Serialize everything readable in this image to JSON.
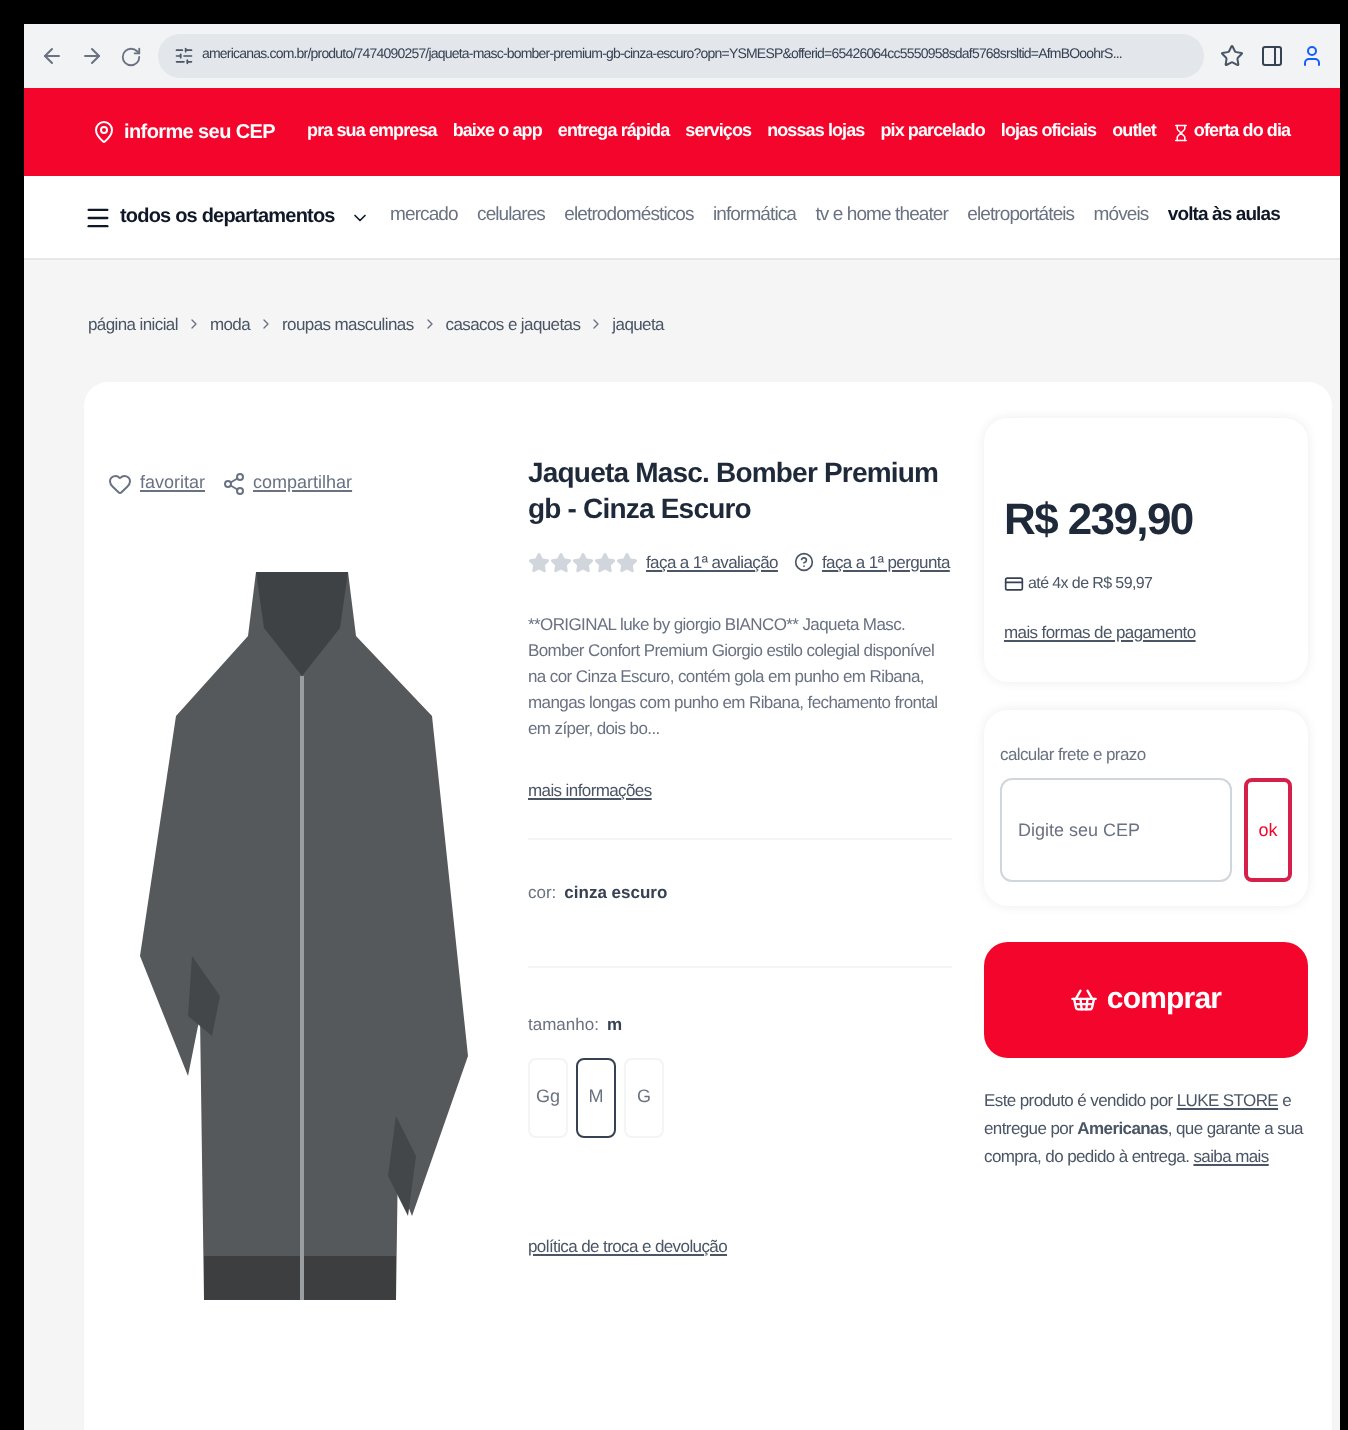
{
  "browser": {
    "url": "americanas.com.br/produto/7474090257/jaqueta-masc-bomber-premium-gb-cinza-escuro?opn=YSMESP&offerid=65426064cc5550958sdaf5768srsltid=AfmBOoohrS..."
  },
  "topbar": {
    "cep": "informe seu CEP",
    "links": [
      {
        "text": "pra sua empresa",
        "kind": "plain"
      },
      {
        "text": "baixe o app",
        "kind": "plain"
      },
      {
        "text": "entrega rápida",
        "kind": "plain"
      },
      {
        "text": "serviços",
        "kind": "plain"
      },
      {
        "text": "nossas lojas",
        "kind": "plain"
      },
      {
        "text": "pix parcelado",
        "kind": "plain"
      },
      {
        "text": "lojas oficiais",
        "kind": "plain"
      },
      {
        "text": "outlet",
        "kind": "plain"
      },
      {
        "text": "oferta do dia",
        "kind": "icon"
      }
    ]
  },
  "departments": {
    "menu": "todos os departamentos",
    "items": [
      {
        "text": "mercado",
        "bold": false
      },
      {
        "text": "celulares",
        "bold": false
      },
      {
        "text": "eletrodomésticos",
        "bold": false
      },
      {
        "text": "informática",
        "bold": false
      },
      {
        "text": "tv e home theater",
        "bold": false
      },
      {
        "text": "eletroportáteis",
        "bold": false
      },
      {
        "text": "móveis",
        "bold": false
      },
      {
        "text": "volta às aulas",
        "bold": true
      }
    ]
  },
  "breadcrumb": [
    "página inicial",
    "moda",
    "roupas masculinas",
    "casacos e jaquetas",
    "jaqueta"
  ],
  "product": {
    "favorite": "favoritar",
    "share": "compartilhar",
    "title": "Jaqueta Masc. Bomber Premium gb - Cinza Escuro",
    "stars": 0,
    "review_link": "faça a 1ª avaliação",
    "question_link": "faça a 1ª pergunta",
    "description": "**ORIGINAL luke by giorgio BIANCO** Jaqueta Masc. Bomber Confort Premium Giorgio estilo colegial disponível na cor Cinza Escuro, contém gola em punho em Ribana, mangas longas com punho em Ribana, fechamento frontal em zíper, dois bo...",
    "more_info": "mais informações",
    "color_label": "cor:",
    "color_value": "cinza escuro",
    "size_label": "tamanho:",
    "size_value": "m",
    "sizes": [
      {
        "label": "Gg",
        "selected": false
      },
      {
        "label": "M",
        "selected": true
      },
      {
        "label": "G",
        "selected": false
      }
    ],
    "return_policy": "política de troca e devolução"
  },
  "price": {
    "value": "R$ 239,90",
    "installments": "até 4x de R$ 59,97",
    "more_payment": "mais formas de pagamento"
  },
  "shipping": {
    "label": "calcular frete e prazo",
    "placeholder": "Digite seu CEP",
    "button": "ok"
  },
  "buy": {
    "button": "comprar"
  },
  "seller": [
    {
      "kind": "text",
      "text": "Este produto é vendido por "
    },
    {
      "kind": "link",
      "text": "LUKE STORE"
    },
    {
      "kind": "text",
      "text": " e entregue por **Americanas**, que garante a sua compra, do pedido à entrega. "
    },
    {
      "kind": "link",
      "text": "saiba mais"
    }
  ]
}
